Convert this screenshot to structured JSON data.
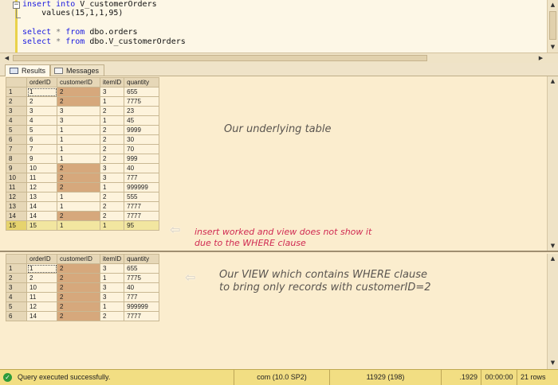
{
  "editor": {
    "lines": [
      [
        "insert into V_customerOrders"
      ],
      [
        "    values(15,1,1,95)"
      ],
      [
        ""
      ],
      [
        "select * from dbo.orders"
      ],
      [
        "select * from dbo.V_customerOrders"
      ]
    ],
    "fold_glyph": "−"
  },
  "tabs": {
    "results": "Results",
    "messages": "Messages"
  },
  "grid1": {
    "columns": [
      "orderID",
      "customerID",
      "itemID",
      "quantity"
    ],
    "rows": [
      [
        "1",
        "1",
        "2",
        "3",
        "655"
      ],
      [
        "2",
        "2",
        "2",
        "1",
        "7775"
      ],
      [
        "3",
        "3",
        "3",
        "2",
        "23"
      ],
      [
        "4",
        "4",
        "3",
        "1",
        "45"
      ],
      [
        "5",
        "5",
        "1",
        "2",
        "9999"
      ],
      [
        "6",
        "6",
        "1",
        "2",
        "30"
      ],
      [
        "7",
        "7",
        "1",
        "2",
        "70"
      ],
      [
        "8",
        "9",
        "1",
        "2",
        "999"
      ],
      [
        "9",
        "10",
        "2",
        "3",
        "40"
      ],
      [
        "10",
        "11",
        "2",
        "3",
        "777"
      ],
      [
        "11",
        "12",
        "2",
        "1",
        "999999"
      ],
      [
        "12",
        "13",
        "1",
        "2",
        "555"
      ],
      [
        "13",
        "14",
        "1",
        "2",
        "7777"
      ],
      [
        "14",
        "14",
        "2",
        "2",
        "7777"
      ],
      [
        "15",
        "15",
        "1",
        "1",
        "95"
      ]
    ]
  },
  "grid2": {
    "columns": [
      "orderID",
      "customerID",
      "itemID",
      "quantity"
    ],
    "rows": [
      [
        "1",
        "1",
        "2",
        "3",
        "655"
      ],
      [
        "2",
        "2",
        "2",
        "1",
        "7775"
      ],
      [
        "3",
        "10",
        "2",
        "3",
        "40"
      ],
      [
        "4",
        "11",
        "2",
        "3",
        "777"
      ],
      [
        "5",
        "12",
        "2",
        "1",
        "999999"
      ],
      [
        "6",
        "14",
        "2",
        "2",
        "7777"
      ]
    ]
  },
  "annotations": {
    "underlying": "Our underlying table",
    "insert_line1": "insert worked and view does not show it",
    "insert_line2": "due to the WHERE clause",
    "view_line1": "Our VIEW which contains WHERE clause",
    "view_line2": "to bring only records with customerID=2"
  },
  "status": {
    "message": "Query executed successfully.",
    "server": "com (10.0 SP2)",
    "user": "11929 (198)",
    "db": ".1929",
    "time": "00:00:00",
    "rows": "21 rows"
  },
  "colors": {
    "highlight_row": "#f2e6a0",
    "selected_col": "#d6a87c",
    "note_red": "#d02a52",
    "status_bar": "#f2de83"
  }
}
